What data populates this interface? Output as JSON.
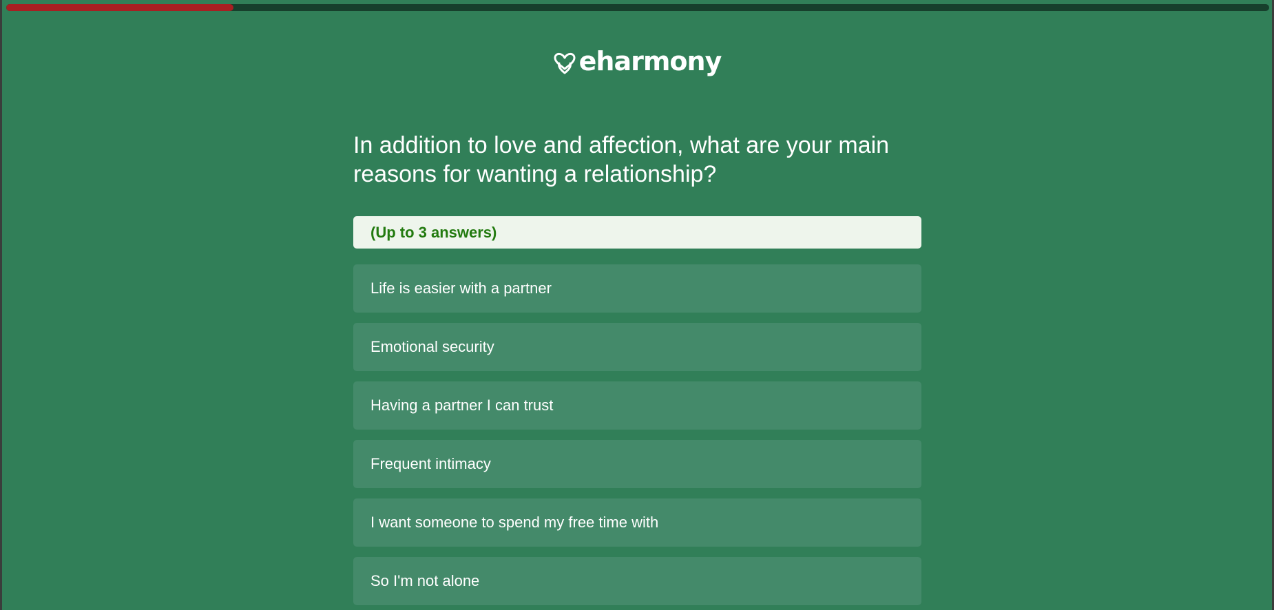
{
  "progress": {
    "percent": 18
  },
  "brand": {
    "name": "eharmony",
    "icon": "heart-logo-icon"
  },
  "question": {
    "title": "In addition to love and affection, what are your main reasons for wanting a relationship?",
    "hint": "(Up to 3 answers)"
  },
  "options": [
    {
      "label": "Life is easier with a partner"
    },
    {
      "label": "Emotional security"
    },
    {
      "label": "Having a partner I can trust"
    },
    {
      "label": "Frequent intimacy"
    },
    {
      "label": "I want someone to spend my free time with"
    },
    {
      "label": "So I'm not alone"
    }
  ],
  "colors": {
    "background": "#317f58",
    "progress_track": "#173f2c",
    "progress_fill": "#a81f22",
    "option_bg": "#448a6a",
    "hint_bg": "#eef5ec",
    "hint_text": "#227a0f"
  }
}
